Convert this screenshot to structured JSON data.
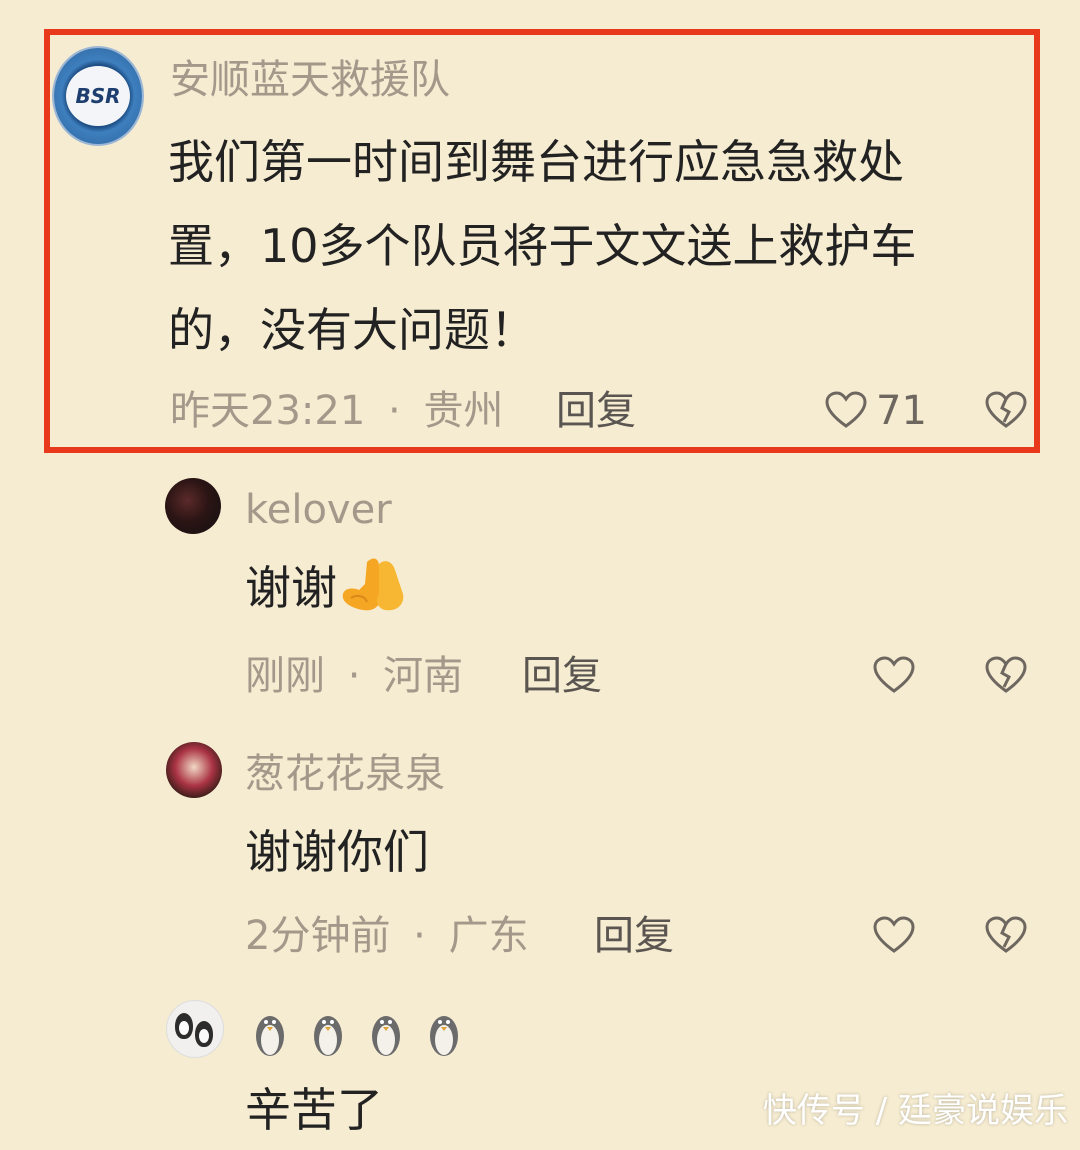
{
  "comments": [
    {
      "username": "安顺蓝天救援队",
      "avatar_text": "BSR",
      "text_lines": [
        "我们第一时间到舞台进行应急急救处",
        "置，10多个队员将于文文送上救护车",
        "的，没有大问题！"
      ],
      "time": "昨天23:21",
      "location": "贵州",
      "reply_label": "回复",
      "like_count": "71"
    },
    {
      "username": "kelover",
      "text": "谢谢",
      "time": "刚刚",
      "location": "河南",
      "reply_label": "回复"
    },
    {
      "username": "葱花花泉泉",
      "text": "谢谢你们",
      "time": "2分钟前",
      "location": "广东",
      "reply_label": "回复"
    },
    {
      "username_icons": "penguin-emoji x4",
      "text": "辛苦了"
    }
  ],
  "separator": "·",
  "watermark": "快传号 / 廷豪说娱乐",
  "colors": {
    "background": "#f6ecd1",
    "highlight_border": "#e8391c",
    "meta_text": "#a3988a"
  }
}
